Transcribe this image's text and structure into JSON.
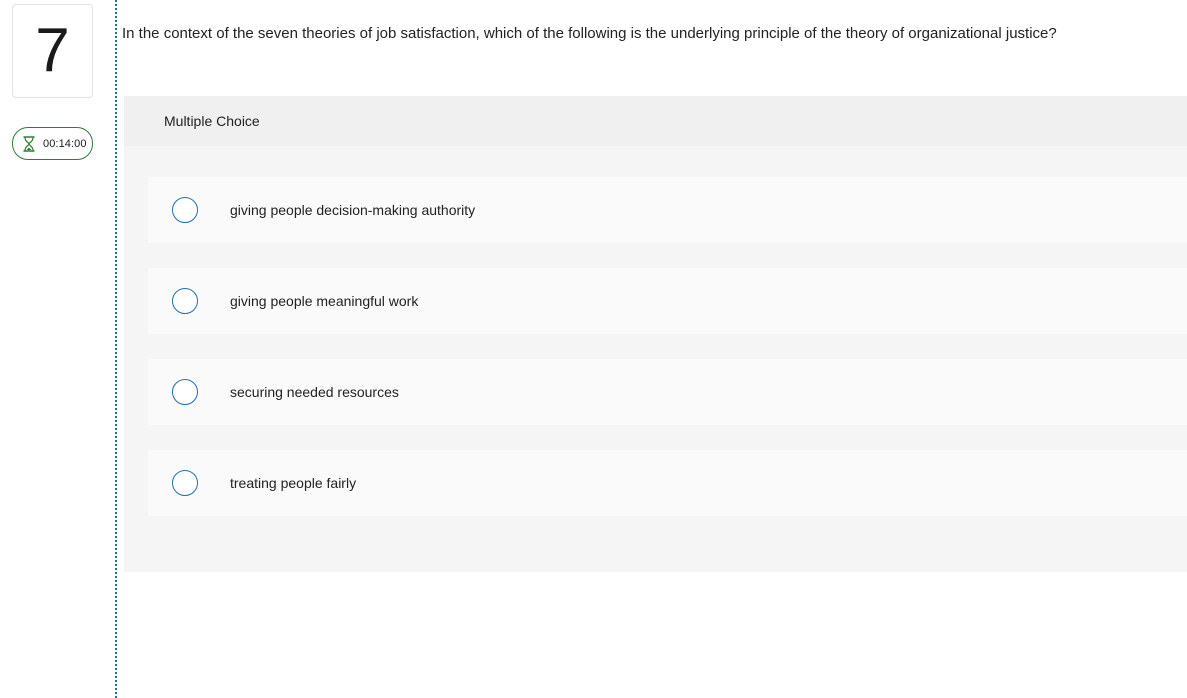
{
  "question": {
    "number": "7",
    "text": "In the context of the seven theories of job satisfaction, which of the following is the underlying principle of the theory of organizational justice?"
  },
  "timer": {
    "value": "00:14:00",
    "icon": "hourglass-icon"
  },
  "answer_panel": {
    "type_label": "Multiple Choice",
    "choices": [
      {
        "label": "giving people decision-making authority"
      },
      {
        "label": "giving people meaningful work"
      },
      {
        "label": "securing needed resources"
      },
      {
        "label": "treating people fairly"
      }
    ]
  },
  "colors": {
    "accent": "#1f6fb5",
    "timer_border": "#2e7d32",
    "panel_bg": "#f5f5f5",
    "choice_bg": "#fafafa"
  }
}
